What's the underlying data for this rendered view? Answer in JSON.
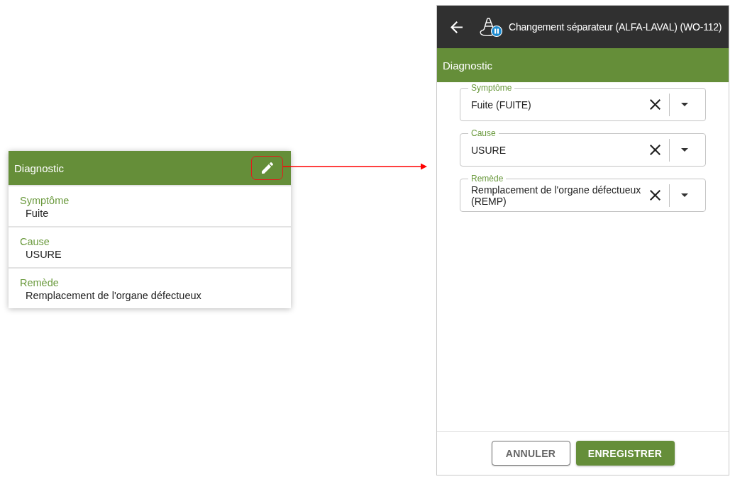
{
  "summary_card": {
    "title": "Diagnostic",
    "edit_button": {
      "highlighted": true
    },
    "fields": [
      {
        "label": "Symptôme",
        "value": "Fuite"
      },
      {
        "label": "Cause",
        "value": "USURE"
      },
      {
        "label": "Remède",
        "value": "Remplacement de l'organe défectueux"
      }
    ]
  },
  "phone": {
    "app_bar": {
      "title": "Changement séparateur (ALFA-LAVAL) (WO-112)"
    },
    "section": {
      "title": "Diagnostic"
    },
    "selects": [
      {
        "label": "Symptôme",
        "value": "Fuite (FUITE)"
      },
      {
        "label": "Cause",
        "value": "USURE"
      },
      {
        "label": "Remède",
        "value": "Remplacement de l'organe défectueux (REMP)"
      }
    ],
    "buttons": [
      {
        "label": "ANNULER",
        "kind": "outlined"
      },
      {
        "label": "ENREGISTRER",
        "kind": "contained"
      }
    ]
  }
}
